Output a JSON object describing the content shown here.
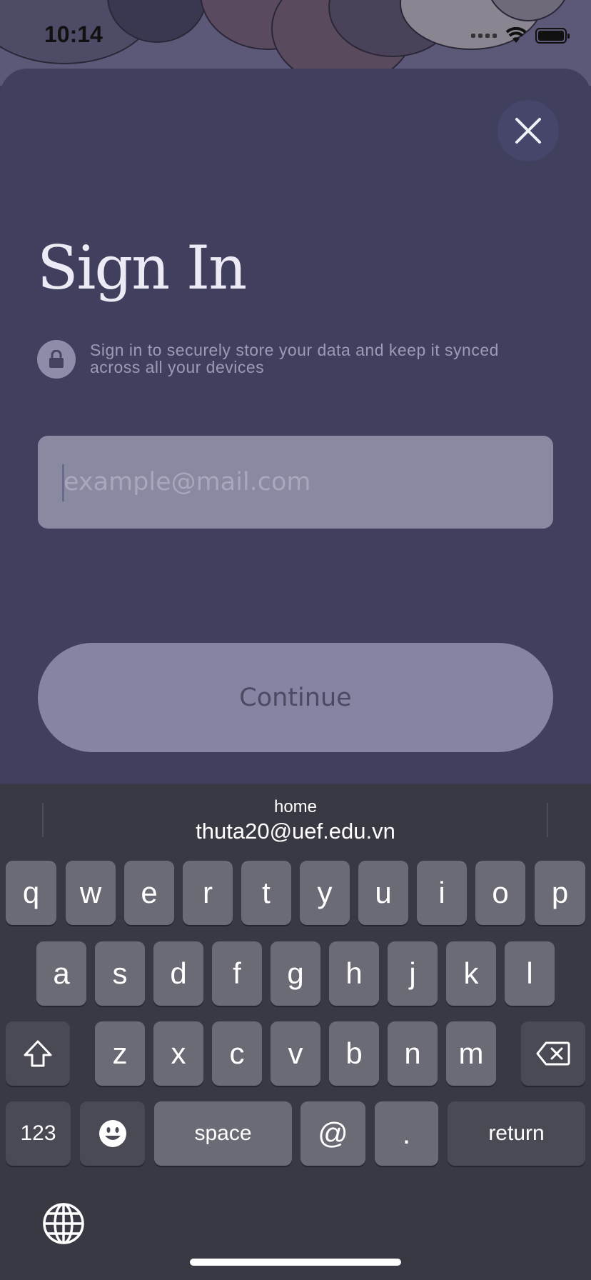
{
  "status_bar": {
    "time": "10:14"
  },
  "sheet": {
    "title": "Sign In",
    "notice": "Sign in to securely store your data and keep it synced across all your devices",
    "email_placeholder": "example@mail.com",
    "continue_label": "Continue"
  },
  "keyboard": {
    "suggestion": {
      "label": "home",
      "value": "thuta20@uef.edu.vn"
    },
    "row1": [
      "q",
      "w",
      "e",
      "r",
      "t",
      "y",
      "u",
      "i",
      "o",
      "p"
    ],
    "row2": [
      "a",
      "s",
      "d",
      "f",
      "g",
      "h",
      "j",
      "k",
      "l"
    ],
    "row3": [
      "z",
      "x",
      "c",
      "v",
      "b",
      "n",
      "m"
    ],
    "numbers_label": "123",
    "space_label": "space",
    "at_label": "@",
    "dot_label": ".",
    "return_label": "return"
  },
  "colors": {
    "sheet": "#40405e",
    "input": "#8a89a2",
    "button": "#8584a2",
    "keyboard": "#393944"
  }
}
